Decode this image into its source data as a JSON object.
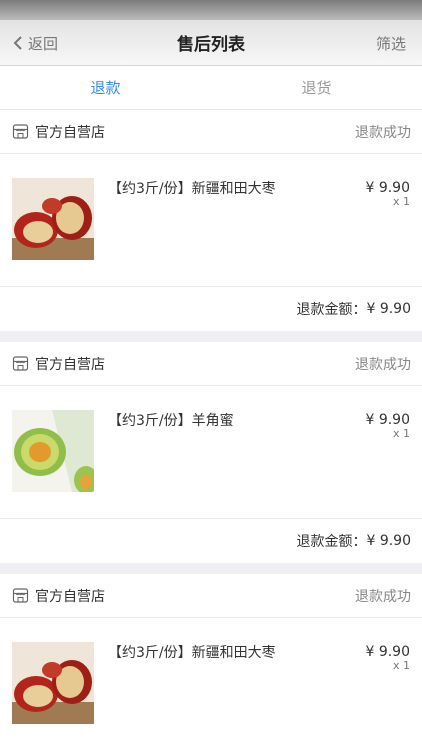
{
  "nav": {
    "back_label": "返回",
    "title": "售后列表",
    "filter_label": "筛选"
  },
  "tabs": [
    {
      "label": "退款",
      "active": true
    },
    {
      "label": "退货",
      "active": false
    }
  ],
  "colors": {
    "accent": "#3a8ddc",
    "separator": "#efeff4"
  },
  "orders": [
    {
      "shop": "官方自营店",
      "status": "退款成功",
      "product": "【约3斤/份】新疆和田大枣",
      "image": "jujube-image",
      "price": "¥ 9.90",
      "quantity": "x 1",
      "refund_label": "退款金额：",
      "refund_amount": "¥ 9.90"
    },
    {
      "shop": "官方自营店",
      "status": "退款成功",
      "product": "【约3斤/份】羊角蜜",
      "image": "melon-image",
      "price": "¥ 9.90",
      "quantity": "x 1",
      "refund_label": "退款金额：",
      "refund_amount": "¥ 9.90"
    },
    {
      "shop": "官方自营店",
      "status": "退款成功",
      "product": "【约3斤/份】新疆和田大枣",
      "image": "jujube-image",
      "price": "¥ 9.90",
      "quantity": "x 1"
    }
  ]
}
